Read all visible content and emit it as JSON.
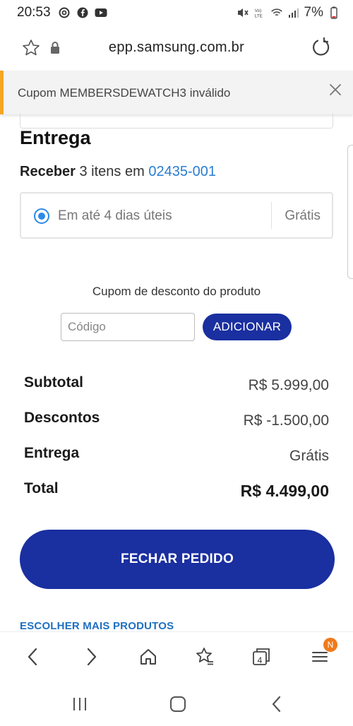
{
  "status_bar": {
    "time": "20:53",
    "battery": "7%",
    "left_icons": [
      "threads-icon",
      "facebook-icon",
      "youtube-icon"
    ],
    "right_icons": [
      "mute-icon",
      "volte-icon",
      "wifi-icon",
      "signal-icon"
    ]
  },
  "browser": {
    "url": "epp.samsung.com.br"
  },
  "toast": {
    "message": "Cupom MEMBERSDEWATCH3 inválido"
  },
  "delivery": {
    "title": "Entrega",
    "receive_label": "Receber",
    "receive_items": "3 itens em",
    "zip": "02435-001",
    "option_label": "Em até 4 dias úteis",
    "option_price": "Grátis"
  },
  "coupon": {
    "title": "Cupom de desconto do produto",
    "placeholder": "Código",
    "button": "ADICIONAR"
  },
  "summary": {
    "subtotal_label": "Subtotal",
    "subtotal_value": "R$ 5.999,00",
    "discount_label": "Descontos",
    "discount_value": "R$ -1.500,00",
    "delivery_label": "Entrega",
    "delivery_value": "Grátis",
    "total_label": "Total",
    "total_value": "R$ 4.499,00"
  },
  "actions": {
    "checkout": "FECHAR PEDIDO",
    "more_products": "ESCOLHER MAIS PRODUTOS"
  },
  "browser_nav": {
    "tab_count": "4",
    "menu_badge": "N"
  },
  "colors": {
    "primary": "#1a2fa0",
    "link": "#2a7dd1",
    "toast_accent": "#f5a623",
    "badge": "#f07a1a"
  }
}
